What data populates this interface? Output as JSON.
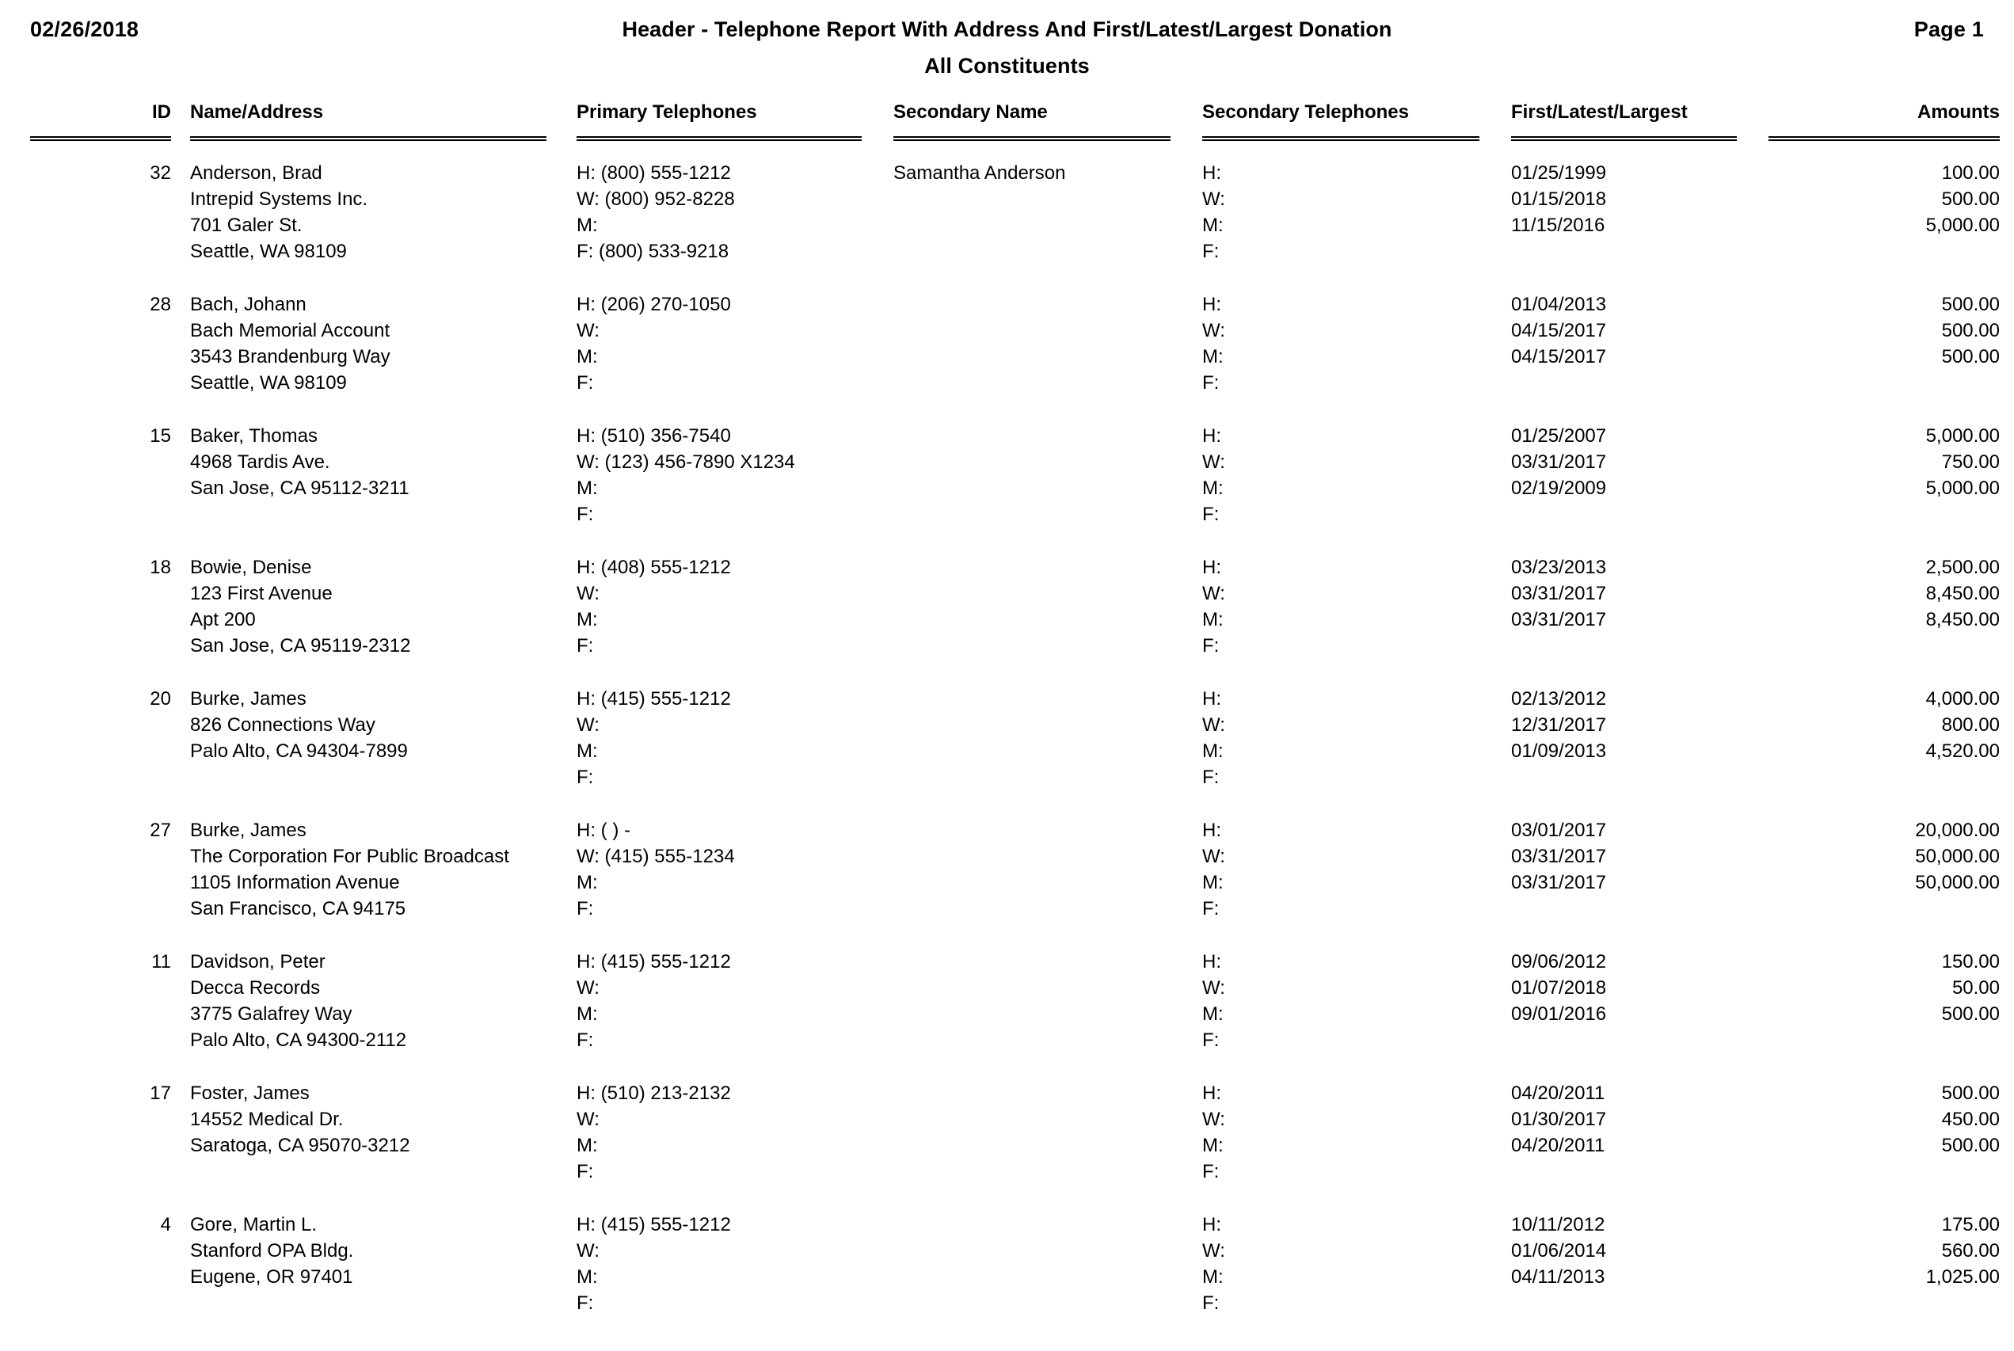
{
  "header": {
    "date": "02/26/2018",
    "title": "Header - Telephone Report With Address And First/Latest/Largest Donation",
    "subtitle": "All Constituents",
    "page": "Page 1"
  },
  "columns": {
    "id": "ID",
    "name_address": "Name/Address",
    "primary_telephones": "Primary Telephones",
    "secondary_name": "Secondary Name",
    "secondary_telephones": "Secondary Telephones",
    "first_latest_largest": "First/Latest/Largest",
    "amounts": "Amounts"
  },
  "records": [
    {
      "id": "32",
      "name_address": [
        "Anderson, Brad",
        "Intrepid Systems Inc.",
        "701 Galer St.",
        "Seattle, WA 98109"
      ],
      "primary_telephones": [
        "H:  (800) 555-1212",
        "W: (800) 952-8228",
        "M:",
        "F:  (800) 533-9218"
      ],
      "secondary_name": [
        "Samantha Anderson"
      ],
      "secondary_telephones": [
        "H:",
        "W:",
        "M:",
        "F:"
      ],
      "dates": [
        "01/25/1999",
        "01/15/2018",
        "11/15/2016"
      ],
      "amounts": [
        "100.00",
        "500.00",
        "5,000.00"
      ]
    },
    {
      "id": "28",
      "name_address": [
        "Bach, Johann",
        "Bach Memorial Account",
        "3543 Brandenburg Way",
        "Seattle, WA 98109"
      ],
      "primary_telephones": [
        "H:  (206) 270-1050",
        "W:",
        "M:",
        "F:"
      ],
      "secondary_name": [],
      "secondary_telephones": [
        "H:",
        "W:",
        "M:",
        "F:"
      ],
      "dates": [
        "01/04/2013",
        "04/15/2017",
        "04/15/2017"
      ],
      "amounts": [
        "500.00",
        "500.00",
        "500.00"
      ]
    },
    {
      "id": "15",
      "name_address": [
        "Baker, Thomas",
        "4968 Tardis Ave.",
        "San Jose, CA 95112-3211"
      ],
      "primary_telephones": [
        "H:  (510) 356-7540",
        "W: (123) 456-7890 X1234",
        "M:",
        "F:"
      ],
      "secondary_name": [],
      "secondary_telephones": [
        "H:",
        "W:",
        "M:",
        "F:"
      ],
      "dates": [
        "01/25/2007",
        "03/31/2017",
        "02/19/2009"
      ],
      "amounts": [
        "5,000.00",
        "750.00",
        "5,000.00"
      ]
    },
    {
      "id": "18",
      "name_address": [
        "Bowie, Denise",
        "123 First Avenue",
        "Apt 200",
        "San Jose, CA 95119-2312"
      ],
      "primary_telephones": [
        "H:  (408) 555-1212",
        "W:",
        "M:",
        "F:"
      ],
      "secondary_name": [],
      "secondary_telephones": [
        "H:",
        "W:",
        "M:",
        "F:"
      ],
      "dates": [
        "03/23/2013",
        "03/31/2017",
        "03/31/2017"
      ],
      "amounts": [
        "2,500.00",
        "8,450.00",
        "8,450.00"
      ]
    },
    {
      "id": "20",
      "name_address": [
        "Burke, James",
        "826 Connections Way",
        "Palo Alto, CA 94304-7899"
      ],
      "primary_telephones": [
        "H:  (415) 555-1212",
        "W:",
        "M:",
        "F:"
      ],
      "secondary_name": [],
      "secondary_telephones": [
        "H:",
        "W:",
        "M:",
        "F:"
      ],
      "dates": [
        "02/13/2012",
        "12/31/2017",
        "01/09/2013"
      ],
      "amounts": [
        "4,000.00",
        "800.00",
        "4,520.00"
      ]
    },
    {
      "id": "27",
      "name_address": [
        "Burke, James",
        "The Corporation For Public Broadcast",
        "1105 Information Avenue",
        "San Francisco, CA 94175"
      ],
      "primary_telephones": [
        "H:  (  )   -",
        "W: (415) 555-1234",
        "M:",
        "F:"
      ],
      "secondary_name": [],
      "secondary_telephones": [
        "H:",
        "W:",
        "M:",
        "F:"
      ],
      "dates": [
        "03/01/2017",
        "03/31/2017",
        "03/31/2017"
      ],
      "amounts": [
        "20,000.00",
        "50,000.00",
        "50,000.00"
      ]
    },
    {
      "id": "11",
      "name_address": [
        "Davidson, Peter",
        "Decca Records",
        "3775 Galafrey Way",
        "Palo Alto, CA 94300-2112"
      ],
      "primary_telephones": [
        "H:  (415) 555-1212",
        "W:",
        "M:",
        "F:"
      ],
      "secondary_name": [],
      "secondary_telephones": [
        "H:",
        "W:",
        "M:",
        "F:"
      ],
      "dates": [
        "09/06/2012",
        "01/07/2018",
        "09/01/2016"
      ],
      "amounts": [
        "150.00",
        "50.00",
        "500.00"
      ]
    },
    {
      "id": "17",
      "name_address": [
        "Foster, James",
        "14552 Medical Dr.",
        "Saratoga, CA 95070-3212"
      ],
      "primary_telephones": [
        "H:  (510) 213-2132",
        "W:",
        "M:",
        "F:"
      ],
      "secondary_name": [],
      "secondary_telephones": [
        "H:",
        "W:",
        "M:",
        "F:"
      ],
      "dates": [
        "04/20/2011",
        "01/30/2017",
        "04/20/2011"
      ],
      "amounts": [
        "500.00",
        "450.00",
        "500.00"
      ]
    },
    {
      "id": "4",
      "name_address": [
        "Gore, Martin L.",
        "Stanford OPA Bldg.",
        "Eugene, OR 97401"
      ],
      "primary_telephones": [
        "H:  (415) 555-1212",
        "W:",
        "M:",
        "F:"
      ],
      "secondary_name": [],
      "secondary_telephones": [
        "H:",
        "W:",
        "M:",
        "F:"
      ],
      "dates": [
        "10/11/2012",
        "01/06/2014",
        "04/11/2013"
      ],
      "amounts": [
        "175.00",
        "560.00",
        "1,025.00"
      ]
    }
  ]
}
